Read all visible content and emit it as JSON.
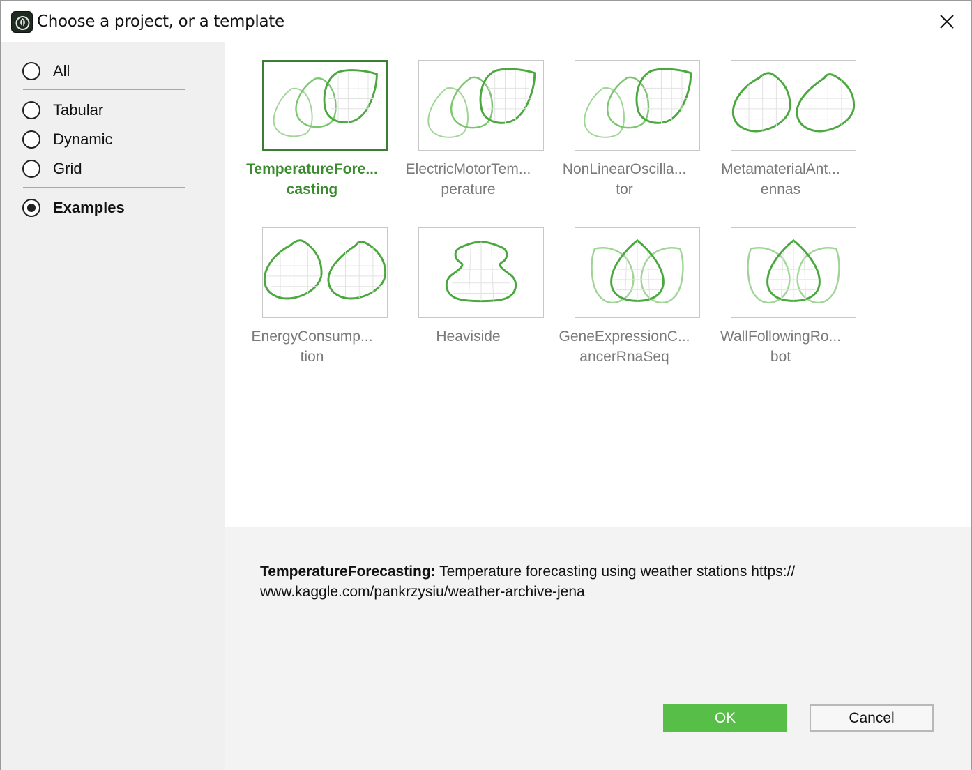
{
  "window": {
    "title": "Choose a project, or a template"
  },
  "sidebar": {
    "items": [
      {
        "label": "All",
        "checked": false
      },
      {
        "label": "Tabular",
        "checked": false
      },
      {
        "label": "Dynamic",
        "checked": false
      },
      {
        "label": "Grid",
        "checked": false
      },
      {
        "label": "Examples",
        "checked": true
      }
    ]
  },
  "projects": [
    {
      "line1": "TemperatureFore...",
      "line2": "casting",
      "selected": true,
      "icon": "three-leaves-icon"
    },
    {
      "line1": "ElectricMotorTem...",
      "line2": "perature",
      "selected": false,
      "icon": "three-leaves-icon"
    },
    {
      "line1": "NonLinearOscilla...",
      "line2": "tor",
      "selected": false,
      "icon": "three-leaves-icon"
    },
    {
      "line1": "MetamaterialAnt...",
      "line2": "ennas",
      "selected": false,
      "icon": "two-leaves-icon"
    },
    {
      "line1": "EnergyConsump...",
      "line2": "tion",
      "selected": false,
      "icon": "two-leaves-icon"
    },
    {
      "line1": "Heaviside",
      "line2": "",
      "selected": false,
      "icon": "vase-leaf-icon"
    },
    {
      "line1": "GeneExpressionC...",
      "line2": "ancerRnaSeq",
      "selected": false,
      "icon": "lotus-leaves-icon"
    },
    {
      "line1": "WallFollowingRo...",
      "line2": "bot",
      "selected": false,
      "icon": "lotus-leaves-icon"
    }
  ],
  "description": {
    "name": "TemperatureForecasting:",
    "text": " Temperature forecasting using weather stations https://",
    "text2": "www.kaggle.com/pankrzysiu/weather-archive-jena"
  },
  "buttons": {
    "ok": "OK",
    "cancel": "Cancel"
  },
  "colors": {
    "accent": "#57be47",
    "selected_text": "#3a8a2e",
    "leaf_dark": "#4aa83f",
    "leaf_light": "#9fd696"
  }
}
